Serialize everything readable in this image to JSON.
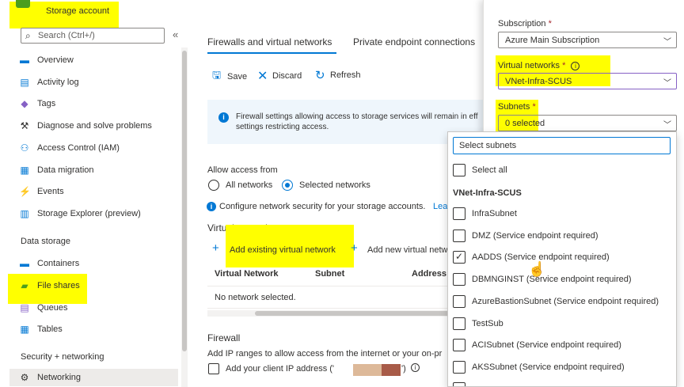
{
  "sidebar": {
    "title": "Storage account",
    "search_placeholder": "Search (Ctrl+/)",
    "collapse_glyph": "«",
    "items": [
      {
        "label": "Overview",
        "icon": "overview-icon"
      },
      {
        "label": "Activity log",
        "icon": "activity-log-icon"
      },
      {
        "label": "Tags",
        "icon": "tag-icon"
      },
      {
        "label": "Diagnose and solve problems",
        "icon": "wrench-icon"
      },
      {
        "label": "Access Control (IAM)",
        "icon": "people-icon"
      },
      {
        "label": "Data migration",
        "icon": "data-migration-icon"
      },
      {
        "label": "Events",
        "icon": "lightning-icon"
      },
      {
        "label": "Storage Explorer (preview)",
        "icon": "storage-explorer-icon"
      }
    ],
    "section_data_storage": "Data storage",
    "data_storage_items": [
      {
        "label": "Containers",
        "icon": "containers-icon"
      },
      {
        "label": "File shares",
        "icon": "file-shares-icon"
      },
      {
        "label": "Queues",
        "icon": "queues-icon"
      },
      {
        "label": "Tables",
        "icon": "tables-icon"
      }
    ],
    "section_security": "Security + networking",
    "security_items": [
      {
        "label": "Networking",
        "icon": "networking-icon"
      }
    ]
  },
  "main": {
    "tabs": [
      {
        "label": "Firewalls and virtual networks",
        "selected": true
      },
      {
        "label": "Private endpoint connections",
        "selected": false
      }
    ],
    "toolbar": {
      "save": "Save",
      "discard": "Discard",
      "refresh": "Refresh"
    },
    "info_text": "Firewall settings allowing access to storage services will remain in eff settings restricting access.",
    "allow_access_label": "Allow access from",
    "radio_all": "All networks",
    "radio_selected": "Selected networks",
    "configure_text": "Configure network security for your storage accounts.",
    "configure_link": "Lea",
    "vnet_heading": "Virtual networks",
    "add_existing": "Add existing virtual network",
    "add_new": "Add new virtual netw",
    "table_headers": [
      "Virtual Network",
      "Subnet",
      "Address r"
    ],
    "empty_row": "No network selected.",
    "firewall_heading": "Firewall",
    "firewall_desc": "Add IP ranges to allow access from the internet or your on-pr",
    "client_ip_label": "Add your client IP address ('",
    "client_ip_suffix": "')"
  },
  "panel": {
    "subscription_label": "Subscription",
    "subscription_value": "Azure Main Subscription",
    "vnet_label": "Virtual networks",
    "vnet_value": "VNet-Infra-SCUS",
    "subnets_label": "Subnets",
    "subnets_value": "0 selected",
    "required_mark": "*"
  },
  "subnet_dropdown": {
    "search_placeholder": "Select subnets",
    "select_all": "Select all",
    "group": "VNet-Infra-SCUS",
    "options": [
      {
        "label": "InfraSubnet",
        "checked": false
      },
      {
        "label": "DMZ (Service endpoint required)",
        "checked": false
      },
      {
        "label": "AADDS (Service endpoint required)",
        "checked": true
      },
      {
        "label": "DBMNGINST (Service endpoint required)",
        "checked": false
      },
      {
        "label": "AzureBastionSubnet (Service endpoint required)",
        "checked": false
      },
      {
        "label": "TestSub",
        "checked": false
      },
      {
        "label": "ACISubnet (Service endpoint required)",
        "checked": false
      },
      {
        "label": "AKSSubnet (Service endpoint required)",
        "checked": false
      }
    ]
  },
  "colors": {
    "accent": "#0078d4",
    "highlight": "#ffff00",
    "required": "#a4262c"
  }
}
